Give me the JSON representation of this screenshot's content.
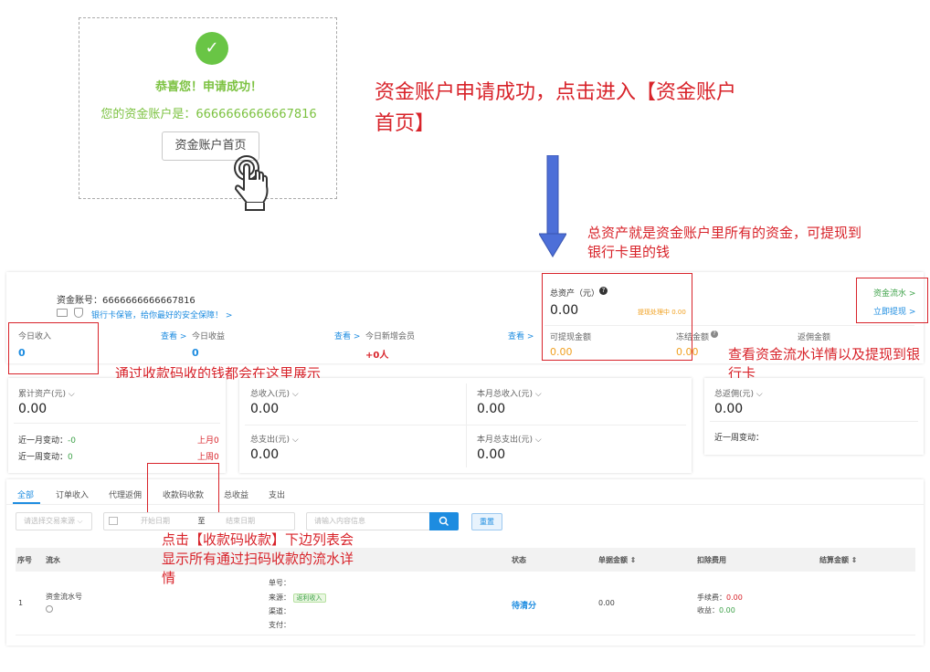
{
  "success": {
    "check": "✓",
    "title": "恭喜您！申请成功！",
    "account_line": "您的资金账户是：6666666666667816",
    "button": "资金账户首页"
  },
  "annotations": {
    "top": "资金账户申请成功，点击进入【资金账户首页】",
    "total_assets": "总资产就是资金账户里所有的资金，可提现到银行卡里的钱",
    "today_income": "通过收款码收的钱都会在这里展示",
    "right_links": "查看资金流水详情以及提现到银行卡",
    "tab": "点击【收款码收款】下边列表会显示所有通过扫码收款的流水详情"
  },
  "account": {
    "label": "资金账号：6666666666667816",
    "bank_note": "银行卡保管，给你最好的安全保障！",
    "chevron": ">"
  },
  "stats": [
    {
      "label": "今日收入",
      "link": "查看 >",
      "value": "0"
    },
    {
      "label": "今日收益",
      "link": "查看 >",
      "value": "0"
    },
    {
      "label": "今日新增会员",
      "link": "查看 >",
      "value": "+0人"
    }
  ],
  "assets": {
    "label": "总资产（元）",
    "help": "?",
    "value": "0.00",
    "processing": "提现处理中 0.00",
    "withdrawable_label": "可提现金额",
    "withdrawable_value": "0.00",
    "frozen_label": "冻结金额",
    "frozen_value": "0.00",
    "rebate_label": "返佣金额"
  },
  "links": {
    "flow": "资金流水 >",
    "withdraw": "立即提现 >"
  },
  "cards": {
    "cumulative": {
      "label": "累计资产(元)",
      "value": "0.00",
      "month_label": "近一月变动：",
      "month_value": "-0",
      "month_prev": "上月0",
      "week_label": "近一周变动：",
      "week_value": "0",
      "week_prev": "上周0"
    },
    "totals": [
      {
        "label": "总收入(元)",
        "value": "0.00"
      },
      {
        "label": "本月总收入(元)",
        "value": "0.00"
      },
      {
        "label": "总支出(元)",
        "value": "0.00"
      },
      {
        "label": "本月总支出(元)",
        "value": "0.00"
      }
    ],
    "rebate": {
      "label": "总返佣(元)",
      "value": "0.00",
      "week_label": "近一周变动："
    }
  },
  "tabs": [
    "全部",
    "订单收入",
    "代理返佣",
    "收款码收款",
    "总收益",
    "支出"
  ],
  "filters": {
    "source_placeholder": "请选择交易来源",
    "start_placeholder": "开始日期",
    "to": "至",
    "end_placeholder": "结束日期",
    "search_placeholder": "请输入内容信息",
    "reset": "重置"
  },
  "table": {
    "headers": [
      "序号",
      "流水",
      "状态",
      "单据金额",
      "扣除费用",
      "结算金额"
    ],
    "row": {
      "index": "1",
      "flow": "资金流水号",
      "order_no": "单号：",
      "source": "来源：",
      "source_tag": "返利收入",
      "channel": "渠道：",
      "pay": "支付：",
      "status": "待清分",
      "amount": "0.00",
      "fee_label": "手续费：",
      "fee_value": "0.00",
      "income_label": "收益：",
      "income_value": "0.00"
    }
  }
}
